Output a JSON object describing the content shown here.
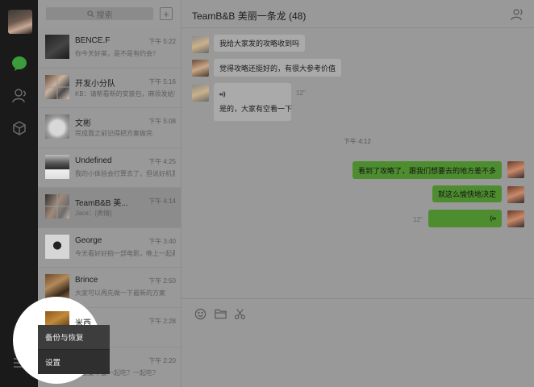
{
  "app": "WeChat",
  "search": {
    "placeholder": "搜索"
  },
  "list": {
    "add_label": "+",
    "items": [
      {
        "name": "BENCE.F",
        "time": "下午 5:22",
        "preview": "你今天好美，是不是有约会？",
        "avatar": "av-dark"
      },
      {
        "name": "开发小分队",
        "time": "下午 5:16",
        "preview": "KB：请帮看新的安装包，麻烦发给我",
        "avatar": "av-grid"
      },
      {
        "name": "文彬",
        "time": "下午 5:08",
        "preview": "完成我之前记得把方案做完",
        "avatar": "av-cat"
      },
      {
        "name": "Undefined",
        "time": "下午 4:25",
        "preview": "我的小体验会打算去了，但说好机票呢",
        "avatar": "av-man"
      },
      {
        "name": "TeamB&B 美...",
        "time": "下午 4:14",
        "preview": "Jace：[表情]",
        "avatar": "av-grid2"
      },
      {
        "name": "George",
        "time": "下午 3:40",
        "preview": "今天看好好拍一部电影，晚上一起看",
        "avatar": "av-glasses"
      },
      {
        "name": "Brince",
        "time": "下午 2:50",
        "preview": "大家可以再先做一下最新的方案",
        "avatar": "av-guitar"
      },
      {
        "name": "米西",
        "time": "下午 2:28",
        "preview": "",
        "avatar": "av-orange"
      },
      {
        "name": "",
        "time": "下午 2:20",
        "preview": "晚上要不要一起吃？一起吃？",
        "avatar": "av-last"
      }
    ]
  },
  "chat": {
    "title": "TeamB&B 美丽一条龙 (48)",
    "incoming": [
      {
        "text": "我给大家发的攻略收到吗"
      },
      {
        "text": "觉得攻略还挺好的，有很大参考价值"
      },
      {
        "text": "是的，大家有空看一下",
        "voice_duration": "12\""
      }
    ],
    "timestamp": "下午 4:12",
    "outgoing": [
      {
        "text": "看到了攻略了，跟我们想要去的地方差不多"
      },
      {
        "text": "就这么愉快地决定"
      },
      {
        "text": "",
        "voice_duration": "12\""
      }
    ]
  },
  "menu": {
    "items": [
      {
        "label": "备份与恢复"
      },
      {
        "label": "设置"
      }
    ]
  },
  "colors": {
    "rail": "#1a1a1a",
    "outgoing_bubble": "#4d8d2f",
    "active_chat_icon": "#3c9b3c"
  },
  "icons": [
    "chat-icon",
    "contacts-icon",
    "favorites-icon",
    "menu-icon",
    "search-icon",
    "members-icon",
    "emoji-icon",
    "folder-icon",
    "scissors-icon",
    "voice-icon"
  ]
}
